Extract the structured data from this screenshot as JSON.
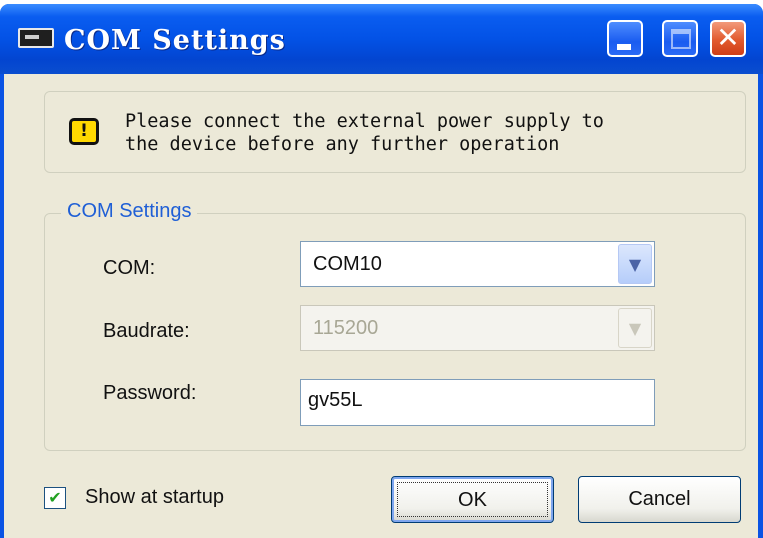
{
  "window": {
    "title": "COM Settings",
    "icon": "console-icon",
    "controls": {
      "minimize": "minimize-icon",
      "maximize": "maximize-icon",
      "close": "close-icon",
      "close_glyph": "✕"
    },
    "accent_color": "#0a53e4"
  },
  "notice": {
    "icon": "warning-icon",
    "icon_glyph": "!",
    "text": "Please connect the external power supply to\nthe device before any further operation"
  },
  "group": {
    "legend": "COM Settings",
    "com": {
      "label": "COM:",
      "value": "COM10"
    },
    "baudrate": {
      "label": "Baudrate:",
      "value": "115200",
      "disabled": true
    },
    "password": {
      "label": "Password:",
      "value": "gv55L"
    }
  },
  "footer": {
    "show_at_startup": {
      "label": "Show at startup",
      "checked": true,
      "glyph": "✔"
    },
    "ok_label": "OK",
    "cancel_label": "Cancel"
  },
  "arrow_glyph": "▼"
}
